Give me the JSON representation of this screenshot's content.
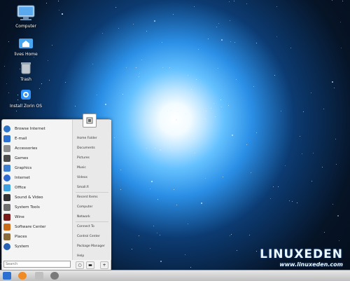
{
  "desktop": {
    "icons": [
      {
        "label": "Computer"
      },
      {
        "label": "lives Home"
      },
      {
        "label": "Trash"
      },
      {
        "label": "Install Zorin OS"
      }
    ]
  },
  "menu": {
    "apps": [
      {
        "label": "Browse Internet",
        "color": "#2d73c9"
      },
      {
        "label": "E-mail",
        "color": "#2b6fd1"
      },
      {
        "label": "Accessories",
        "color": "#8c8c8c"
      },
      {
        "label": "Games",
        "color": "#4d4d4d"
      },
      {
        "label": "Graphics",
        "color": "#3c7fd0"
      },
      {
        "label": "Internet",
        "color": "#2e6bd1"
      },
      {
        "label": "Office",
        "color": "#3da0e0"
      },
      {
        "label": "Sound & Video",
        "color": "#333333"
      },
      {
        "label": "System Tools",
        "color": "#6e6e6e"
      },
      {
        "label": "Wine",
        "color": "#7a1b1b"
      },
      {
        "label": "Software Center",
        "color": "#c96a1b"
      },
      {
        "label": "Places",
        "color": "#8b6a3c"
      },
      {
        "label": "System",
        "color": "#2a62b3"
      }
    ],
    "places": [
      "Home Folder",
      "Documents",
      "Pictures",
      "Music",
      "Videos",
      "Small.fi",
      "Recent Items",
      "Computer",
      "Network",
      "Connect To",
      "Control Center",
      "Package Manager",
      "Help"
    ],
    "search": {
      "placeholder": "Search"
    }
  },
  "taskbar": {
    "items": [
      "menu-button",
      "firefox-icon",
      "folder-icon",
      "headphones-icon"
    ]
  },
  "watermark": {
    "brand": "LINUXEDEN",
    "url": "www.linuxeden.com"
  },
  "colors": {
    "menu_bg": "#f4f4f4",
    "places_bg": "#e9e9e9",
    "taskbar": "#d6d6d6",
    "accent": "#2b6fd1"
  }
}
